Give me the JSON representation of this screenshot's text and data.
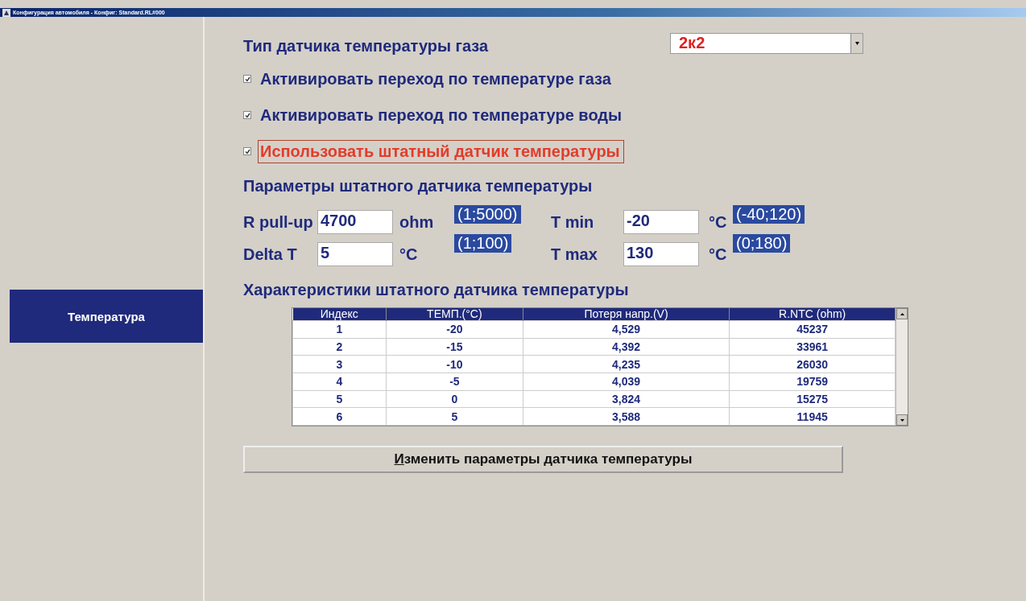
{
  "window": {
    "title": "Конфигурация автомобиля - Конфиг: Standard.RL#000"
  },
  "sidebar": {
    "items": [
      {
        "label": "Температура",
        "selected": true
      }
    ]
  },
  "gas_sensor_type": {
    "label": "Тип датчика температуры газа",
    "value": "2к2"
  },
  "checkboxes": [
    {
      "label": "Активировать переход по температуре газа",
      "checked": true,
      "highlighted": false
    },
    {
      "label": "Активировать переход по температуре воды",
      "checked": true,
      "highlighted": false
    },
    {
      "label": "Использовать штатный датчик температуры",
      "checked": true,
      "highlighted": true
    }
  ],
  "params_title": "Параметры штатного датчика температуры",
  "params": [
    {
      "label": "R pull-up",
      "value": "4700",
      "unit": "ohm",
      "range": "(1;5000)"
    },
    {
      "label": "T min",
      "value": "-20",
      "unit": "°C",
      "range": "(-40;120)"
    },
    {
      "label": "Delta T",
      "value": "5",
      "unit": "°C",
      "range": "(1;100)"
    },
    {
      "label": "T max",
      "value": "130",
      "unit": "°C",
      "range": "(0;180)"
    }
  ],
  "table_title": "Характеристики штатного датчика температуры",
  "table": {
    "columns": [
      "Индекс",
      "ТЕМП.(°C)",
      "Потеря напр.(V)",
      "R.NTC (ohm)"
    ],
    "rows": [
      [
        "1",
        "-20",
        "4,529",
        "45237"
      ],
      [
        "2",
        "-15",
        "4,392",
        "33961"
      ],
      [
        "3",
        "-10",
        "4,235",
        "26030"
      ],
      [
        "4",
        "-5",
        "4,039",
        "19759"
      ],
      [
        "5",
        "0",
        "3,824",
        "15275"
      ],
      [
        "6",
        "5",
        "3,588",
        "11945"
      ]
    ]
  },
  "button": {
    "label": "Изменить параметры датчика температуры"
  }
}
